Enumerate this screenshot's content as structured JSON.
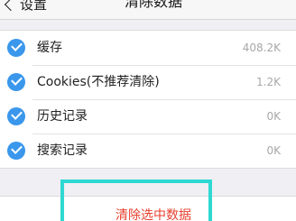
{
  "nav": {
    "back_label": "设置",
    "title": "清除数据"
  },
  "items": [
    {
      "label": "缓存",
      "size": "408.2K",
      "checked": true
    },
    {
      "label": "Cookies(不推荐清除)",
      "size": "1.2K",
      "checked": true
    },
    {
      "label": "历史记录",
      "size": "0K",
      "checked": true
    },
    {
      "label": "搜索记录",
      "size": "0K",
      "checked": true
    }
  ],
  "action": {
    "clear_label": "清除选中数据"
  },
  "colors": {
    "accent_blue": "#3a97ec",
    "danger_red": "#e8402f",
    "highlight_cyan": "#2fd9d2"
  }
}
